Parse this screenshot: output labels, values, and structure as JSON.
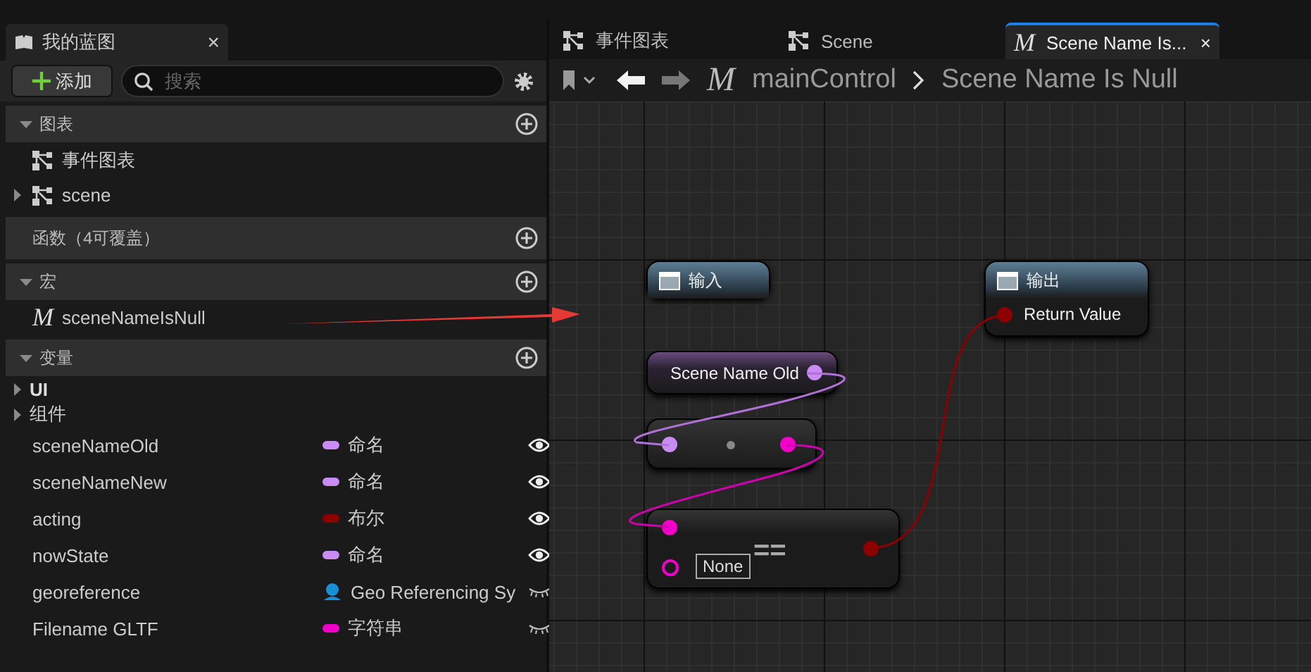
{
  "blueprint_panel": {
    "tab": {
      "title": "我的蓝图",
      "close": "×"
    },
    "add_button": {
      "label": "添加"
    },
    "search": {
      "placeholder": "搜索"
    },
    "sections": [
      {
        "title": "图表",
        "expanded": true,
        "items": [
          {
            "kind": "graph",
            "label": "事件图表"
          },
          {
            "kind": "graph",
            "label": "scene",
            "expanded": false
          }
        ]
      },
      {
        "title": "函数（4可覆盖）"
      },
      {
        "title": "宏",
        "expanded": true,
        "items": [
          {
            "kind": "macro",
            "glyph": "M",
            "label": "sceneNameIsNull"
          }
        ]
      },
      {
        "title": "变量",
        "expanded": true,
        "items": [
          {
            "kind": "category",
            "label": "UI",
            "expanded": false
          },
          {
            "kind": "category",
            "label": "组件",
            "expanded": false
          },
          {
            "kind": "variable",
            "label": "sceneNameOld",
            "type": "命名",
            "color": "#c98cf2",
            "visible": true
          },
          {
            "kind": "variable",
            "label": "sceneNameNew",
            "type": "命名",
            "color": "#c98cf2",
            "visible": true
          },
          {
            "kind": "variable",
            "label": "acting",
            "type": "布尔",
            "color": "#8c0000",
            "visible": true
          },
          {
            "kind": "variable",
            "label": "nowState",
            "type": "命名",
            "color": "#c98cf2",
            "visible": true
          },
          {
            "kind": "object_variable",
            "label": "georeference",
            "type": "Geo Referencing Sy",
            "color": "#1a8fd8",
            "visible": false
          },
          {
            "kind": "variable",
            "label": "Filename GLTF",
            "type": "字符串",
            "color": "#f000c8",
            "visible": false
          }
        ]
      }
    ]
  },
  "graph_editor": {
    "tabs": [
      {
        "kind": "graph",
        "label": "事件图表",
        "selected": false
      },
      {
        "kind": "graph",
        "label": "Scene",
        "selected": false
      },
      {
        "kind": "macro",
        "glyph": "M",
        "label": "Scene Name Is...",
        "selected": true,
        "close": "×"
      }
    ],
    "toolbar": {
      "back_enabled": true,
      "forward_enabled": false,
      "glyph": "M",
      "breadcrumb": [
        "mainControl",
        "Scene Name Is Null"
      ]
    },
    "nodes": [
      {
        "kind": "tunnel",
        "title": "输入"
      },
      {
        "kind": "tunnel",
        "title": "输出",
        "pin": "Return Value"
      },
      {
        "kind": "variable",
        "label": "Scene Name Old"
      },
      {
        "kind": "conversion"
      },
      {
        "kind": "compare",
        "symbol": "==",
        "default": "None"
      }
    ]
  }
}
